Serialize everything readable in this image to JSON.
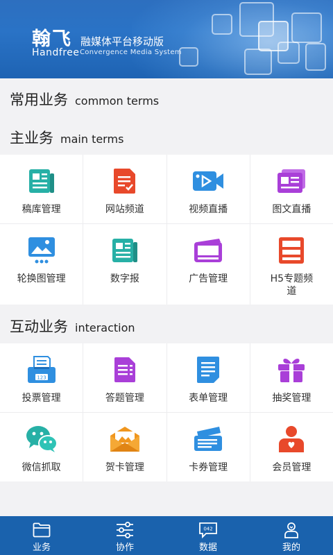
{
  "banner": {
    "logo": "翰飞",
    "logo_en": "Handfree",
    "subtitle": "融媒体平台移动版",
    "subtitle_en": "Convergence Media System"
  },
  "sections": {
    "common": {
      "title": "常用业务",
      "title_en": "common terms"
    },
    "main": {
      "title": "主业务",
      "title_en": "main terms"
    },
    "interaction": {
      "title": "互动业务",
      "title_en": "interaction"
    }
  },
  "main_items": [
    {
      "label": "稿库管理",
      "icon": "document-library-icon",
      "color": "#27b0a6"
    },
    {
      "label": "网站频道",
      "icon": "website-channel-icon",
      "color": "#e8492b"
    },
    {
      "label": "视频直播",
      "icon": "video-camera-icon",
      "color": "#2f8fe0"
    },
    {
      "label": "图文直播",
      "icon": "image-text-icon",
      "color": "#a93fd8"
    },
    {
      "label": "轮换图管理",
      "icon": "image-carousel-icon",
      "color": "#2f8fe0"
    },
    {
      "label": "数字报",
      "icon": "newspaper-icon",
      "color": "#27b0a6"
    },
    {
      "label": "广告管理",
      "icon": "advertisement-icon",
      "color": "#a93fd8"
    },
    {
      "label": "H5专题频道",
      "icon": "h5-topic-icon",
      "color": "#e8492b"
    }
  ],
  "interaction_items": [
    {
      "label": "投票管理",
      "icon": "vote-box-icon",
      "color": "#2f8fe0",
      "badge": "123"
    },
    {
      "label": "答题管理",
      "icon": "quiz-form-icon",
      "color": "#a93fd8"
    },
    {
      "label": "表单管理",
      "icon": "form-list-icon",
      "color": "#2f8fe0"
    },
    {
      "label": "抽奖管理",
      "icon": "gift-icon",
      "color": "#a93fd8"
    },
    {
      "label": "微信抓取",
      "icon": "wechat-icon",
      "color": "#27b0a6"
    },
    {
      "label": "贺卡管理",
      "icon": "greeting-card-icon",
      "color": "#f0961e"
    },
    {
      "label": "卡券管理",
      "icon": "coupon-ticket-icon",
      "color": "#2f8fe0"
    },
    {
      "label": "会员管理",
      "icon": "member-icon",
      "color": "#e8492b"
    }
  ],
  "tabbar": [
    {
      "label": "业务",
      "icon": "folder-icon"
    },
    {
      "label": "协作",
      "icon": "sliders-icon"
    },
    {
      "label": "数据",
      "icon": "chat-data-icon",
      "icon_text": "042"
    },
    {
      "label": "我的",
      "icon": "user-icon"
    }
  ],
  "colors": {
    "banner": "#2a73c6",
    "tabbar": "#1a62ad",
    "teal": "#27b0a6",
    "red": "#e8492b",
    "blue": "#2f8fe0",
    "purple": "#a93fd8",
    "orange": "#f0961e"
  }
}
